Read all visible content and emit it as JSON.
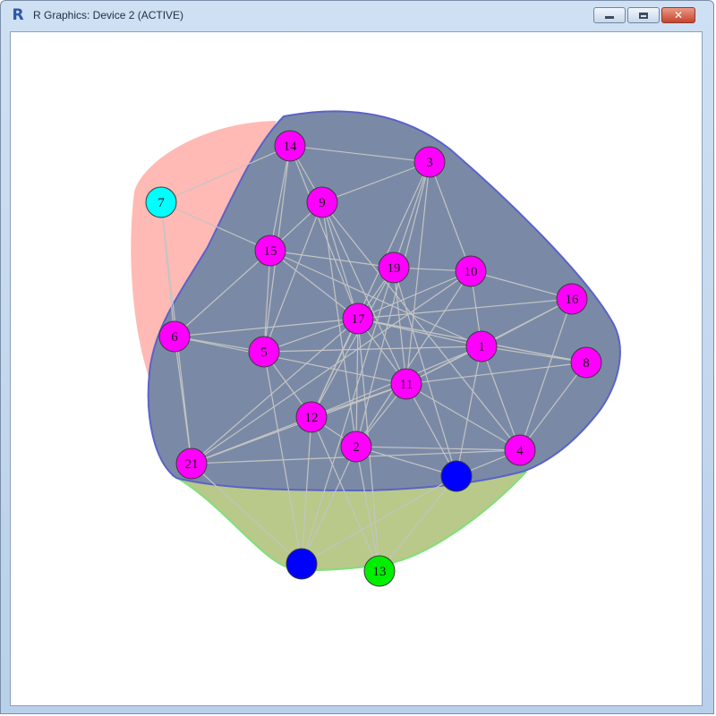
{
  "window": {
    "title": "R Graphics: Device 2 (ACTIVE)",
    "app_icon": "R",
    "controls": {
      "minimize": "minimize-icon",
      "maximize": "maximize-icon",
      "close": "close-icon"
    }
  },
  "graph": {
    "group_colors": {
      "red_group": "#ffb3ad",
      "blue_group": "#7a8aa6",
      "blue_border": "#5a63c8",
      "green_group": "#b8c98a",
      "green_border": "#7fe07a",
      "edge": "#c4c4c4"
    },
    "node_colors": {
      "magenta": "#ff00ff",
      "cyan": "#00ffff",
      "blue": "#0000ff",
      "green": "#00ee00"
    },
    "nodes": [
      {
        "id": "14",
        "label": "14",
        "color": "magenta"
      },
      {
        "id": "3",
        "label": "3",
        "color": "magenta"
      },
      {
        "id": "7",
        "label": "7",
        "color": "cyan"
      },
      {
        "id": "9",
        "label": "9",
        "color": "magenta"
      },
      {
        "id": "15",
        "label": "15",
        "color": "magenta"
      },
      {
        "id": "19",
        "label": "19",
        "color": "magenta"
      },
      {
        "id": "10",
        "label": "10",
        "color": "magenta"
      },
      {
        "id": "16",
        "label": "16",
        "color": "magenta"
      },
      {
        "id": "17",
        "label": "17",
        "color": "magenta"
      },
      {
        "id": "6",
        "label": "6",
        "color": "magenta"
      },
      {
        "id": "5",
        "label": "5",
        "color": "magenta"
      },
      {
        "id": "1",
        "label": "1",
        "color": "magenta"
      },
      {
        "id": "8",
        "label": "8",
        "color": "magenta"
      },
      {
        "id": "11",
        "label": "11",
        "color": "magenta"
      },
      {
        "id": "12",
        "label": "12",
        "color": "magenta"
      },
      {
        "id": "2",
        "label": "2",
        "color": "magenta"
      },
      {
        "id": "4",
        "label": "4",
        "color": "magenta"
      },
      {
        "id": "21",
        "label": "21",
        "color": "magenta"
      },
      {
        "id": "b1",
        "label": "",
        "color": "blue"
      },
      {
        "id": "b2",
        "label": "",
        "color": "blue"
      },
      {
        "id": "13",
        "label": "13",
        "color": "green"
      }
    ],
    "edges": [
      [
        "7",
        "14"
      ],
      [
        "7",
        "6"
      ],
      [
        "7",
        "21"
      ],
      [
        "7",
        "15"
      ],
      [
        "14",
        "3"
      ],
      [
        "14",
        "15"
      ],
      [
        "14",
        "17"
      ],
      [
        "14",
        "5"
      ],
      [
        "14",
        "9"
      ],
      [
        "3",
        "9"
      ],
      [
        "3",
        "10"
      ],
      [
        "3",
        "11"
      ],
      [
        "3",
        "2"
      ],
      [
        "3",
        "12"
      ],
      [
        "3",
        "19"
      ],
      [
        "9",
        "15"
      ],
      [
        "9",
        "17"
      ],
      [
        "9",
        "11"
      ],
      [
        "9",
        "4"
      ],
      [
        "9",
        "5"
      ],
      [
        "9",
        "2"
      ],
      [
        "15",
        "17"
      ],
      [
        "15",
        "19"
      ],
      [
        "15",
        "1"
      ],
      [
        "15",
        "5"
      ],
      [
        "15",
        "6"
      ],
      [
        "19",
        "17"
      ],
      [
        "19",
        "10"
      ],
      [
        "19",
        "11"
      ],
      [
        "19",
        "b1"
      ],
      [
        "19",
        "12"
      ],
      [
        "10",
        "17"
      ],
      [
        "10",
        "1"
      ],
      [
        "10",
        "2"
      ],
      [
        "10",
        "21"
      ],
      [
        "10",
        "16"
      ],
      [
        "16",
        "17"
      ],
      [
        "16",
        "4"
      ],
      [
        "16",
        "11"
      ],
      [
        "16",
        "1"
      ],
      [
        "17",
        "6"
      ],
      [
        "17",
        "5"
      ],
      [
        "17",
        "1"
      ],
      [
        "17",
        "11"
      ],
      [
        "17",
        "12"
      ],
      [
        "17",
        "2"
      ],
      [
        "17",
        "21"
      ],
      [
        "17",
        "8"
      ],
      [
        "6",
        "5"
      ],
      [
        "6",
        "21"
      ],
      [
        "6",
        "11"
      ],
      [
        "5",
        "12"
      ],
      [
        "5",
        "1"
      ],
      [
        "5",
        "b2"
      ],
      [
        "1",
        "11"
      ],
      [
        "1",
        "4"
      ],
      [
        "1",
        "8"
      ],
      [
        "1",
        "12"
      ],
      [
        "1",
        "b1"
      ],
      [
        "8",
        "11"
      ],
      [
        "8",
        "4"
      ],
      [
        "8",
        "17"
      ],
      [
        "11",
        "12"
      ],
      [
        "11",
        "2"
      ],
      [
        "11",
        "4"
      ],
      [
        "11",
        "b1"
      ],
      [
        "11",
        "21"
      ],
      [
        "12",
        "2"
      ],
      [
        "12",
        "21"
      ],
      [
        "12",
        "b2"
      ],
      [
        "12",
        "13"
      ],
      [
        "2",
        "b2"
      ],
      [
        "2",
        "13"
      ],
      [
        "2",
        "4"
      ],
      [
        "4",
        "b1"
      ],
      [
        "4",
        "21"
      ],
      [
        "21",
        "b2"
      ],
      [
        "21",
        "12"
      ],
      [
        "b1",
        "b2"
      ],
      [
        "b1",
        "13"
      ],
      [
        "b1",
        "2"
      ],
      [
        "13",
        "17"
      ],
      [
        "b2",
        "19"
      ]
    ]
  }
}
